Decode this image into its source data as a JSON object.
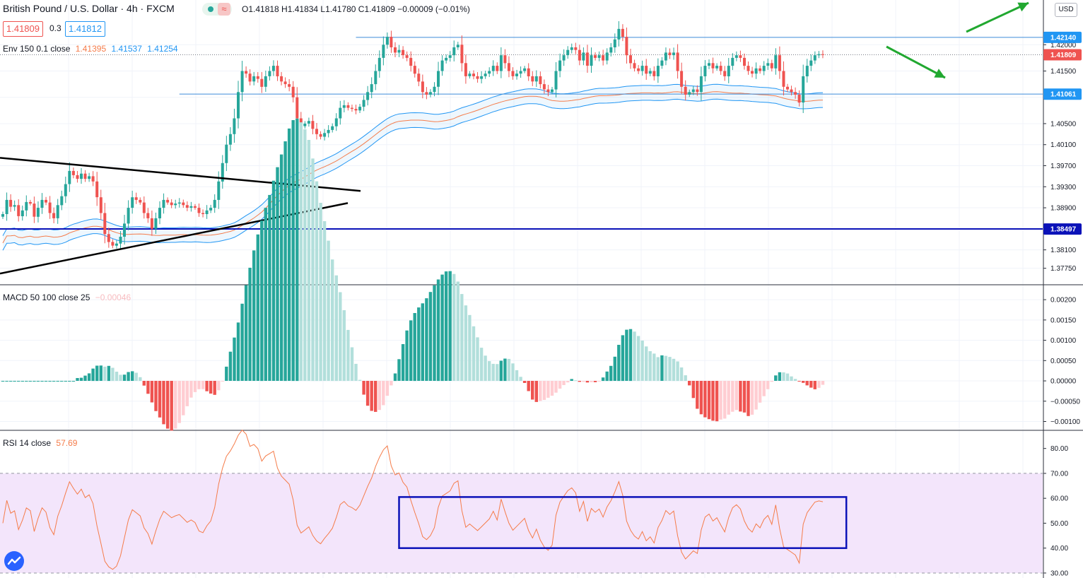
{
  "header": {
    "title": "British Pound / U.S. Dollar · 4h · FXCM",
    "ohlc": "O1.41818 H1.41834 L1.41780 C1.41809 −0.00009 (−0.01%)",
    "bid": "1.41809",
    "spread": "0.3",
    "ask": "1.41812",
    "currency": "USD",
    "wave_glyph": "≈"
  },
  "indicators": {
    "env_label": "Env 150 0.1 close",
    "env_v1": "1.41395",
    "env_v2": "1.41537",
    "env_v3": "1.41254",
    "macd_label": "MACD 50 100 close 25",
    "macd_value": "−0.00046",
    "rsi_label": "RSI 14 close",
    "rsi_value": "57.69"
  },
  "colors": {
    "up": "#26a69a",
    "down": "#ef5350",
    "env_mid": "#f57c4a",
    "env_band": "#2196f3",
    "hline": "#3d8bd9",
    "support": "#0b12b8",
    "macd_up_strong": "#26a69a",
    "macd_up_weak": "#b2dfdb",
    "macd_down_strong": "#ef5350",
    "macd_down_weak": "#ffcdd2",
    "rsi_line": "#f57c4a",
    "rsi_band": "#f3e5fb",
    "rect": "#0b12b8",
    "arrow": "#21a830",
    "trend": "#000000"
  },
  "chart_data": [
    {
      "type": "candlestick",
      "title": "British Pound / U.S. Dollar · 4h · FXCM",
      "ylim": [
        1.3745,
        1.4285
      ],
      "y_ticks": [
        "1.42000",
        "1.41500",
        "1.41000",
        "1.40500",
        "1.40100",
        "1.39700",
        "1.39300",
        "1.38900",
        "1.38100",
        "1.37750"
      ],
      "y_tick_values": [
        1.42,
        1.415,
        1.41,
        1.405,
        1.401,
        1.397,
        1.393,
        1.389,
        1.381,
        1.3775
      ],
      "price_labels": [
        {
          "text": "1.42140",
          "value": 1.4214,
          "color": "#2196f3"
        },
        {
          "text": "1.41809",
          "value": 1.41809,
          "color": "#ef5350"
        },
        {
          "text": "1.41061",
          "value": 1.41061,
          "color": "#2196f3"
        },
        {
          "text": "1.38497",
          "value": 1.38497,
          "color": "#0b12b8"
        }
      ],
      "horizontal_lines": [
        {
          "value": 1.4214,
          "from_bar": 90,
          "style": "solid"
        },
        {
          "value": 1.41061,
          "from_bar": 45,
          "style": "solid"
        },
        {
          "value": 1.38497,
          "from_bar": 0,
          "style": "solid-thick"
        },
        {
          "value": 1.41809,
          "from_bar": 0,
          "style": "dotted"
        }
      ],
      "close_series": [
        1.3878,
        1.3905,
        1.3892,
        1.3895,
        1.3874,
        1.3885,
        1.3901,
        1.3898,
        1.3873,
        1.389,
        1.3905,
        1.39,
        1.388,
        1.387,
        1.3895,
        1.3912,
        1.3935,
        1.396,
        1.3952,
        1.3945,
        1.3955,
        1.3945,
        1.395,
        1.394,
        1.391,
        1.388,
        1.384,
        1.3825,
        1.3818,
        1.3822,
        1.3835,
        1.386,
        1.389,
        1.391,
        1.3905,
        1.39,
        1.388,
        1.387,
        1.385,
        1.387,
        1.389,
        1.3905,
        1.39,
        1.3895,
        1.3898,
        1.39,
        1.3895,
        1.389,
        1.3893,
        1.389,
        1.388,
        1.3878,
        1.3885,
        1.389,
        1.3905,
        1.394,
        1.3975,
        1.401,
        1.403,
        1.406,
        1.411,
        1.415,
        1.4145,
        1.413,
        1.414,
        1.4135,
        1.412,
        1.414,
        1.415,
        1.416,
        1.414,
        1.413,
        1.4125,
        1.412,
        1.41,
        1.406,
        1.4045,
        1.405,
        1.4055,
        1.404,
        1.403,
        1.4025,
        1.4032,
        1.4038,
        1.4045,
        1.406,
        1.408,
        1.4085,
        1.408,
        1.4078,
        1.4075,
        1.4082,
        1.4095,
        1.411,
        1.4125,
        1.415,
        1.4175,
        1.42,
        1.4215,
        1.4195,
        1.4185,
        1.419,
        1.418,
        1.4175,
        1.416,
        1.4145,
        1.413,
        1.411,
        1.4105,
        1.411,
        1.412,
        1.415,
        1.417,
        1.4175,
        1.418,
        1.4195,
        1.42,
        1.4165,
        1.414,
        1.4145,
        1.414,
        1.4135,
        1.414,
        1.4145,
        1.415,
        1.416,
        1.415,
        1.418,
        1.4165,
        1.415,
        1.414,
        1.4145,
        1.415,
        1.4155,
        1.414,
        1.413,
        1.414,
        1.4125,
        1.4115,
        1.411,
        1.4115,
        1.415,
        1.417,
        1.418,
        1.419,
        1.4195,
        1.419,
        1.417,
        1.4185,
        1.416,
        1.418,
        1.4175,
        1.418,
        1.417,
        1.4185,
        1.4195,
        1.421,
        1.423,
        1.4215,
        1.418,
        1.4165,
        1.4155,
        1.415,
        1.416,
        1.4145,
        1.415,
        1.414,
        1.416,
        1.417,
        1.4185,
        1.418,
        1.4185,
        1.415,
        1.412,
        1.4105,
        1.411,
        1.4115,
        1.411,
        1.414,
        1.416,
        1.4165,
        1.4155,
        1.416,
        1.415,
        1.414,
        1.416,
        1.4175,
        1.418,
        1.4175,
        1.416,
        1.415,
        1.4145,
        1.4155,
        1.415,
        1.416,
        1.4165,
        1.4155,
        1.418,
        1.415,
        1.412,
        1.4115,
        1.411,
        1.4105,
        1.409,
        1.414,
        1.416,
        1.417,
        1.418,
        1.4182,
        1.4181
      ]
    },
    {
      "type": "histogram",
      "title": "MACD 50 100 close 25",
      "ylim": [
        -0.0012,
        0.00235
      ],
      "y_ticks": [
        "0.00200",
        "0.00150",
        "0.00100",
        "0.00050",
        "0.00000",
        "−0.00050",
        "−0.00100"
      ],
      "y_tick_values": [
        0.002,
        0.0015,
        0.001,
        0.0005,
        0.0,
        -0.0005,
        -0.001
      ]
    },
    {
      "type": "line",
      "title": "RSI 14 close",
      "ylim": [
        28,
        87
      ],
      "y_ticks": [
        "80.00",
        "70.00",
        "60.00",
        "50.00",
        "40.00",
        "30.00"
      ],
      "y_tick_values": [
        80,
        70,
        60,
        50,
        40,
        30
      ],
      "band": [
        30,
        70
      ],
      "boxed_range": [
        40,
        60.5
      ],
      "boxed_from_bar": 101,
      "boxed_to_bar": 215,
      "current": 57.69
    }
  ]
}
